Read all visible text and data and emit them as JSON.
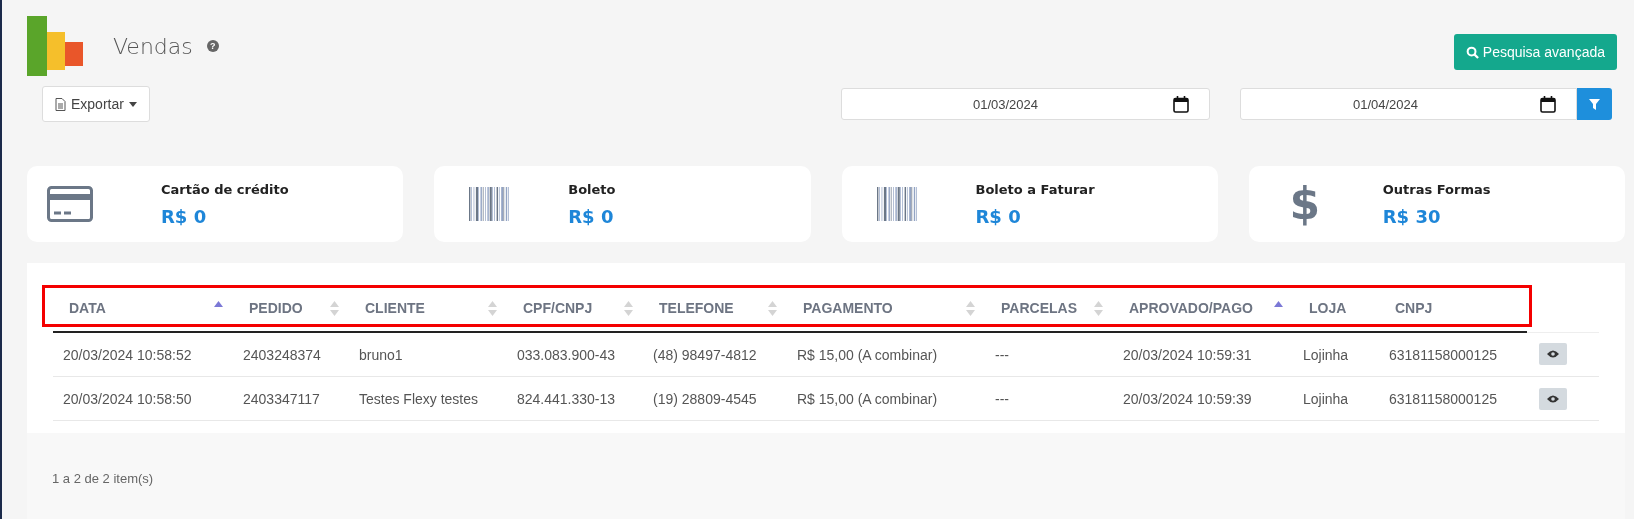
{
  "page": {
    "title": "Vendas",
    "help_icon": "?"
  },
  "toolbar": {
    "export_label": "Exportar",
    "advanced_search_label": "Pesquisa avançada",
    "date_from": "01/03/2024",
    "date_to": "01/04/2024"
  },
  "cards": [
    {
      "kind": "card",
      "label": "Cartão de crédito",
      "value": "R$ 0"
    },
    {
      "kind": "barcode",
      "label": "Boleto",
      "value": "R$ 0"
    },
    {
      "kind": "barcode",
      "label": "Boleto a Faturar",
      "value": "R$ 0"
    },
    {
      "kind": "dollar",
      "icon_text": "$",
      "label": "Outras Formas",
      "value": "R$ 30"
    }
  ],
  "table": {
    "header_highlighted": true,
    "columns": [
      {
        "label": "DATA",
        "sorted_ascending": true
      },
      {
        "label": "PEDIDO",
        "sorted_ascending": false
      },
      {
        "label": "CLIENTE",
        "sorted_ascending": false
      },
      {
        "label": "CPF/CNPJ",
        "sorted_ascending": false
      },
      {
        "label": "TELEFONE",
        "sorted_ascending": false
      },
      {
        "label": "PAGAMENTO",
        "sorted_ascending": false
      },
      {
        "label": "PARCELAS",
        "sorted_ascending": false
      },
      {
        "label": "APROVADO/PAGO",
        "sorted_ascending": true
      },
      {
        "label": "LOJA"
      },
      {
        "label": "CNPJ"
      }
    ],
    "rows": [
      [
        "20/03/2024 10:58:52",
        "2403248374",
        "bruno1",
        "033.083.900-43",
        "(48) 98497-4812",
        "R$ 15,00 (A combinar)",
        "---",
        "20/03/2024 10:59:31",
        "Lojinha",
        "63181158000125"
      ],
      [
        "20/03/2024 10:58:50",
        "2403347117",
        "Testes Flexy testes",
        "824.441.330-13",
        "(19) 28809-4545",
        "R$ 15,00 (A combinar)",
        "---",
        "20/03/2024 10:59:39",
        "Lojinha",
        "63181158000125"
      ]
    ],
    "footer": "1 a 2 de 2 item(s)"
  }
}
